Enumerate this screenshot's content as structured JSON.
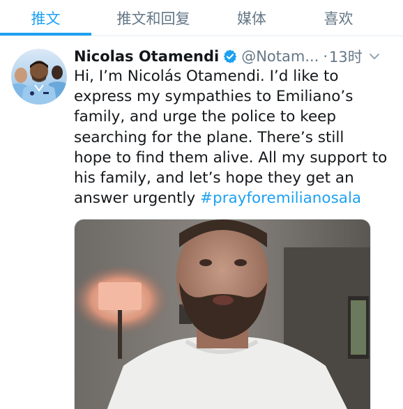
{
  "tabs": [
    {
      "label": "推文",
      "active": true
    },
    {
      "label": "推文和回复",
      "active": false
    },
    {
      "label": "媒体",
      "active": false
    },
    {
      "label": "喜欢",
      "active": false
    }
  ],
  "tweet": {
    "display_name": "Nicolas Otamendi",
    "handle": "@Notam...",
    "separator": "·",
    "time": "13时",
    "verified": true,
    "text_lines": [
      "Hi, I’m Nicolás Otamendi. I’d like to",
      "express my sympathies to Emiliano’s",
      "family, and urge the police to keep",
      "searching for the plane. There’s still",
      "hope to find them alive. All my support to",
      "his family, and let’s hope they get an",
      "answer urgently "
    ],
    "hashtag": "#prayforemilianosala"
  },
  "colors": {
    "accent": "#1da1f2",
    "text": "#14171a",
    "secondary": "#657786",
    "divider": "#e6ecf0"
  },
  "icons": {
    "verified": "verified-badge-icon",
    "menu": "chevron-down-icon"
  }
}
